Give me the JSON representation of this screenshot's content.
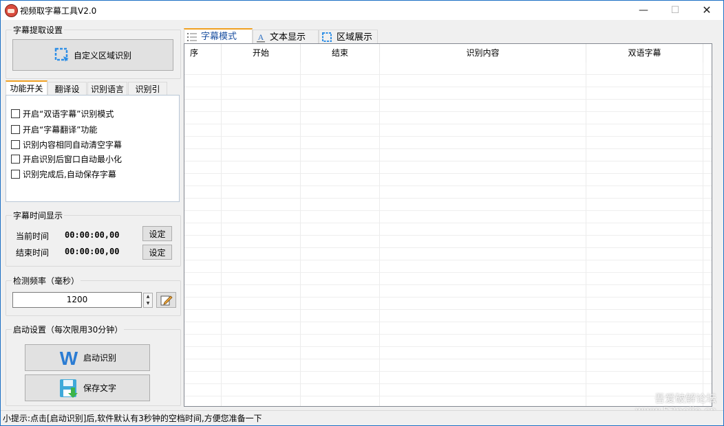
{
  "window": {
    "title": "视频取字幕工具V2.0",
    "min_symbol": "—",
    "max_symbol": "☐",
    "close_symbol": "✕"
  },
  "extract_group": {
    "title": "字幕提取设置",
    "custom_region_button": "自定义区域识别"
  },
  "left_tabs": {
    "items": [
      "功能开关",
      "翻译设置",
      "识别语言",
      "识别引擎"
    ],
    "active_index": 0
  },
  "options": [
    {
      "label": "开启“双语字幕”识别模式",
      "checked": false
    },
    {
      "label": "开启“字幕翻译”功能",
      "checked": false
    },
    {
      "label": "识别内容相同自动清空字幕",
      "checked": false
    },
    {
      "label": "开启识别后窗口自动最小化",
      "checked": false
    },
    {
      "label": "识别完成后,自动保存字幕",
      "checked": false
    }
  ],
  "time_group": {
    "title": "字幕时间显示",
    "current_label": "当前时间",
    "current_value": "00:00:00,00",
    "end_label": "结束时间",
    "end_value": "00:00:00,00",
    "set_button": "设定"
  },
  "freq_group": {
    "title": "检测频率（毫秒）",
    "value": "1200"
  },
  "start_group": {
    "title": "启动设置（每次限用30分钟）",
    "start_button": "启动识别",
    "save_button": "保存文字"
  },
  "right_tabs": {
    "items": [
      {
        "label": "字幕模式",
        "icon": "list-icon"
      },
      {
        "label": "文本显示",
        "icon": "text-icon"
      },
      {
        "label": "区域展示",
        "icon": "region-icon"
      }
    ],
    "active_index": 0
  },
  "table": {
    "columns": [
      "序",
      "开始",
      "结束",
      "识别内容",
      "双语字幕"
    ],
    "rows": []
  },
  "status_bar": {
    "text": "小提示:点击[启动识别]后,软件默认有3秒钟的空档时间,方便您准备一下"
  },
  "watermark": {
    "line1": "吾爱破解论坛",
    "line2": "www.52pojie.cn"
  },
  "colors": {
    "accent_tab": "#f0a020",
    "window_border": "#1a6fc4",
    "word_icon": "#2b7cd3",
    "region_icon": "#2d8ee6"
  }
}
